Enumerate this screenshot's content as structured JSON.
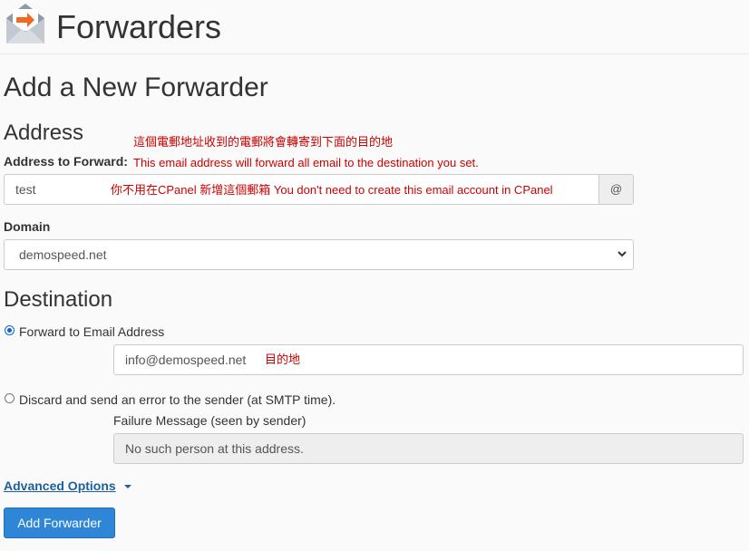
{
  "header": {
    "title": "Forwarders",
    "icon": "mail-forward-icon"
  },
  "add_section": {
    "heading": "Add a New Forwarder"
  },
  "address": {
    "heading": "Address",
    "label": "Address to Forward:",
    "note_zh": "這個電郵地址收到的電郵將會轉寄到下面的目的地",
    "note_en": "This email address will forward all email to the destination you set.",
    "value": "test",
    "input_note": "你不用在CPanel 新增這個郵箱  You don't need to create this email account in CPanel",
    "at_symbol": "@"
  },
  "domain": {
    "label": "Domain",
    "selected": "demospeed.net"
  },
  "destination": {
    "heading": "Destination",
    "forward_option_label": "Forward to Email Address",
    "forward_value": "info@demospeed.net",
    "forward_note": "目的地",
    "discard_option_label": "Discard and send an error to the sender (at SMTP time).",
    "failure_label": "Failure Message (seen by sender)",
    "failure_value": "No such person at this address."
  },
  "advanced": {
    "label": "Advanced Options"
  },
  "submit": {
    "label": "Add Forwarder"
  },
  "colors": {
    "accent": "#2f86d6",
    "note": "#cc0000",
    "link": "#1d5f9e",
    "icon_orange": "#f26722"
  }
}
